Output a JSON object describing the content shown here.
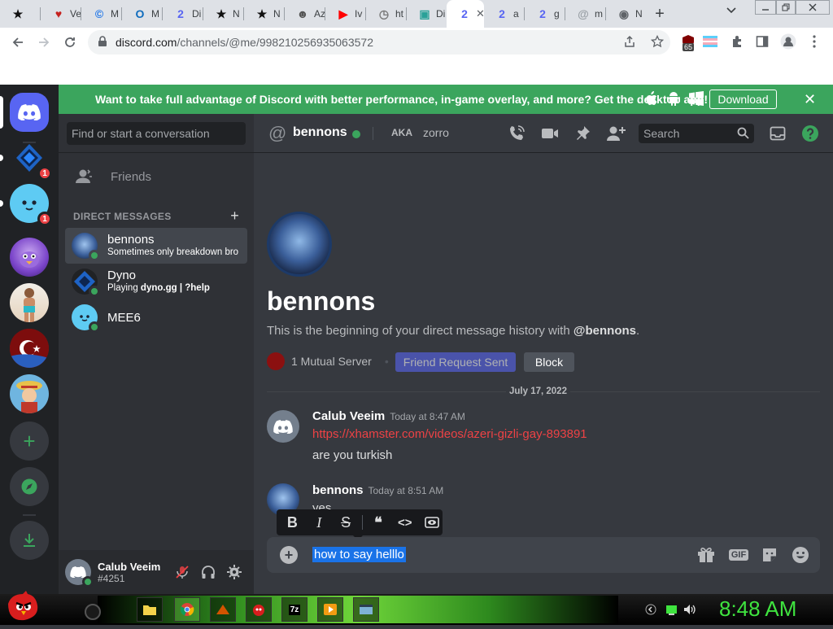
{
  "browser": {
    "tabs": [
      {
        "label": "",
        "icon": "star-icon",
        "color": "#111111"
      },
      {
        "label": "Ve",
        "icon": "heart-icon",
        "color": "#c5221f"
      },
      {
        "label": "M",
        "icon": "copyright-icon",
        "color": "#1a73e8"
      },
      {
        "label": "M",
        "icon": "outlook-icon",
        "color": "#0f6cbd"
      },
      {
        "label": "Di",
        "icon": "discord-badge-icon",
        "color": "#5865f2"
      },
      {
        "label": "N",
        "icon": "star-icon",
        "color": "#111111"
      },
      {
        "label": "N",
        "icon": "star-icon",
        "color": "#111111"
      },
      {
        "label": "Az",
        "icon": "cat-icon",
        "color": "#555555"
      },
      {
        "label": "Iv",
        "icon": "youtube-icon",
        "color": "#ff0000"
      },
      {
        "label": "ht",
        "icon": "clock-icon",
        "color": "#777777"
      },
      {
        "label": "Di",
        "icon": "image-icon",
        "color": "#2aa198"
      },
      {
        "label": "",
        "icon": "discord-badge-icon",
        "color": "#5865f2",
        "active": true
      },
      {
        "label": "a",
        "icon": "discord-badge-icon",
        "color": "#5865f2"
      },
      {
        "label": "g",
        "icon": "discord-badge-icon",
        "color": "#5865f2"
      },
      {
        "label": "m",
        "icon": "at-icon",
        "color": "#9aa0a6"
      },
      {
        "label": "N",
        "icon": "chrome-icon",
        "color": "#5f6368"
      }
    ],
    "new_tab": "+",
    "url_host": "discord.com",
    "url_path": "/channels/@me/998210256935063572",
    "ext_badge": "65"
  },
  "banner": {
    "text": "Want to take full advantage of Discord with better performance, in-game overlay, and more? Get the desktop app!",
    "download_label": "Download",
    "close": "✕"
  },
  "guilds": {
    "badges": [
      "1",
      "1"
    ],
    "add": "+",
    "download": "⤓"
  },
  "dm_sidebar": {
    "search_placeholder": "Find or start a conversation",
    "friends_label": "Friends",
    "header": "DIRECT MESSAGES",
    "add": "+",
    "items": [
      {
        "name": "bennons",
        "sub": "Sometimes only breakdown bro",
        "selected": true
      },
      {
        "name": "Dyno",
        "sub_prefix": "Playing ",
        "sub_bold": "dyno.gg | ?help"
      },
      {
        "name": "MEE6",
        "sub": ""
      }
    ]
  },
  "user_panel": {
    "name": "Calub Veeim",
    "tag": "#4251"
  },
  "chat_header": {
    "at": "@",
    "name": "bennons",
    "aka": "AKA",
    "alias": "zorro",
    "search": "Search"
  },
  "intro": {
    "name": "bennons",
    "desc_prefix": "This is the beginning of your direct message history with ",
    "desc_user": "@bennons",
    "desc_suffix": ".",
    "mutual": "1 Mutual Server",
    "mutual_sep": "•",
    "friend_request": "Friend Request Sent",
    "block": "Block"
  },
  "date_divider": "July 17, 2022",
  "messages": [
    {
      "author": "Calub Veeim",
      "time": "Today at 8:47 AM",
      "link": "https://xhamster.com/videos/azeri-gizli-gay-893891",
      "text": "are you turkish"
    },
    {
      "author": "bennons",
      "time": "Today at 8:51 AM",
      "text": "yes"
    }
  ],
  "format_toolbar": {
    "bold": "B",
    "italic": "I",
    "strike": "S",
    "quote": "❝",
    "code": "<>"
  },
  "composer": {
    "value": "how to say helllo",
    "plus": "+",
    "gif": "GIF"
  },
  "taskbar": {
    "clock": "8:48 AM"
  },
  "colors": {
    "blurple": "#5865f2",
    "green": "#3ba55d",
    "red": "#ed4245",
    "bg": "#36393f"
  }
}
